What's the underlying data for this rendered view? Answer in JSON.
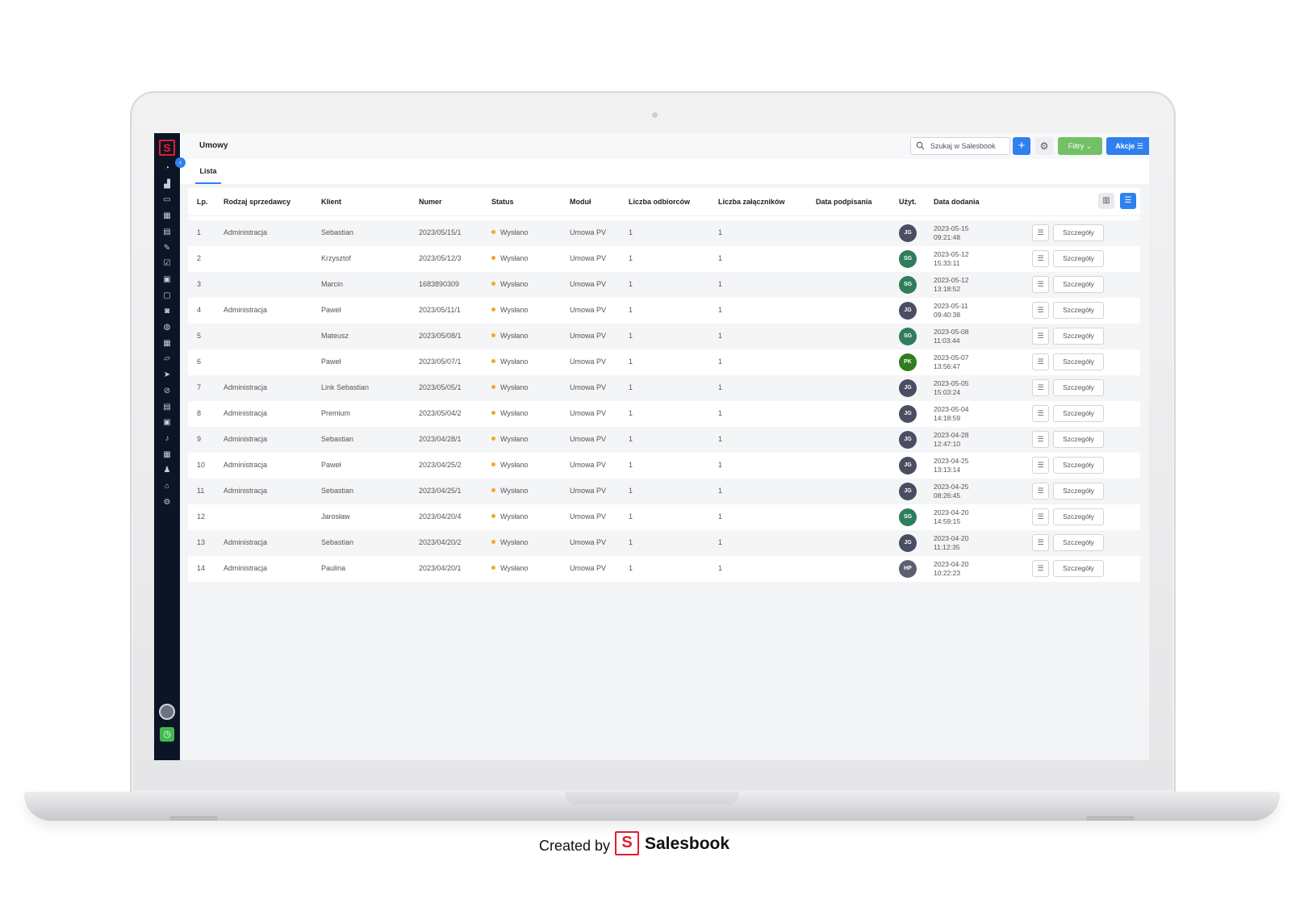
{
  "app": {
    "logo_letter": "S",
    "page_title": "Umowy",
    "search_placeholder": "Szukaj w Salesbook",
    "add_label": "+",
    "settings_glyph": "⚙",
    "filters_label": "Filtry ⌄",
    "actions_label": "Akcje ☰",
    "tabs": [
      {
        "label": "Lista",
        "active": true
      }
    ],
    "accent_color": "#2f80ed",
    "filters_color": "#73c066"
  },
  "sidebar": {
    "icons": [
      "dashboard-icon",
      "chart-icon",
      "chat-icon",
      "building-icon",
      "report-icon",
      "notes-icon",
      "tasks-icon",
      "calendar-icon",
      "folder-icon",
      "gallery-icon",
      "globe-icon",
      "solar-panel-icon",
      "inbox-icon",
      "send-icon",
      "link-icon",
      "mail-icon",
      "box-icon",
      "bell-icon",
      "calculator-icon",
      "users-icon",
      "education-icon",
      "gear-icon"
    ]
  },
  "table": {
    "headers": {
      "lp": "Lp.",
      "seller_type": "Rodzaj sprzedawcy",
      "client": "Klient",
      "number": "Numer",
      "status": "Status",
      "module": "Moduł",
      "recipients": "Liczba odbiorców",
      "attachments": "Liczba załączników",
      "signed": "Data podpisania",
      "user": "Użyt.",
      "added": "Data dodania"
    },
    "details_label": "Szczegóły",
    "status_color": "#f5a623",
    "rows": [
      {
        "lp": "1",
        "seller": "Administracja",
        "client": "Sebastian",
        "number": "2023/05/15/1",
        "status": "Wysłano",
        "module": "Umowa PV",
        "recipients": "1",
        "attachments": "1",
        "user": "JG",
        "user_color": "#4a4e63",
        "date": "2023-05-15",
        "time": "09:21:48"
      },
      {
        "lp": "2",
        "seller": "",
        "client": "Krzysztof",
        "number": "2023/05/12/3",
        "status": "Wysłano",
        "module": "Umowa PV",
        "recipients": "1",
        "attachments": "1",
        "user": "SG",
        "user_color": "#2e7d5b",
        "date": "2023-05-12",
        "time": "15:33:11"
      },
      {
        "lp": "3",
        "seller": "",
        "client": "Marcin",
        "number": "1683890309",
        "status": "Wysłano",
        "module": "Umowa PV",
        "recipients": "1",
        "attachments": "1",
        "user": "SG",
        "user_color": "#2e7d5b",
        "date": "2023-05-12",
        "time": "13:18:52"
      },
      {
        "lp": "4",
        "seller": "Administracja",
        "client": "Paweł",
        "number": "2023/05/11/1",
        "status": "Wysłano",
        "module": "Umowa PV",
        "recipients": "1",
        "attachments": "1",
        "user": "JG",
        "user_color": "#4a4e63",
        "date": "2023-05-11",
        "time": "09:40:38"
      },
      {
        "lp": "5",
        "seller": "",
        "client": "Mateusz",
        "number": "2023/05/08/1",
        "status": "Wysłano",
        "module": "Umowa PV",
        "recipients": "1",
        "attachments": "1",
        "user": "SG",
        "user_color": "#2e7d5b",
        "date": "2023-05-08",
        "time": "11:03:44"
      },
      {
        "lp": "6",
        "seller": "",
        "client": "Paweł",
        "number": "2023/05/07/1",
        "status": "Wysłano",
        "module": "Umowa PV",
        "recipients": "1",
        "attachments": "1",
        "user": "PK",
        "user_color": "#2e7d1e",
        "date": "2023-05-07",
        "time": "13:56:47"
      },
      {
        "lp": "7",
        "seller": "Administracja",
        "client": "Link Sebastian",
        "number": "2023/05/05/1",
        "status": "Wysłano",
        "module": "Umowa PV",
        "recipients": "1",
        "attachments": "1",
        "user": "JG",
        "user_color": "#4a4e63",
        "date": "2023-05-05",
        "time": "15:03:24"
      },
      {
        "lp": "8",
        "seller": "Administracja",
        "client": "Premium",
        "number": "2023/05/04/2",
        "status": "Wysłano",
        "module": "Umowa PV",
        "recipients": "1",
        "attachments": "1",
        "user": "JG",
        "user_color": "#4a4e63",
        "date": "2023-05-04",
        "time": "14:18:59"
      },
      {
        "lp": "9",
        "seller": "Administracja",
        "client": "Sebastian",
        "number": "2023/04/28/1",
        "status": "Wysłano",
        "module": "Umowa PV",
        "recipients": "1",
        "attachments": "1",
        "user": "JG",
        "user_color": "#4a4e63",
        "date": "2023-04-28",
        "time": "12:47:10"
      },
      {
        "lp": "10",
        "seller": "Administracja",
        "client": "Paweł",
        "number": "2023/04/25/2",
        "status": "Wysłano",
        "module": "Umowa PV",
        "recipients": "1",
        "attachments": "1",
        "user": "JG",
        "user_color": "#4a4e63",
        "date": "2023-04-25",
        "time": "13:13:14"
      },
      {
        "lp": "11",
        "seller": "Administracja",
        "client": "Sebastian",
        "number": "2023/04/25/1",
        "status": "Wysłano",
        "module": "Umowa PV",
        "recipients": "1",
        "attachments": "1",
        "user": "JG",
        "user_color": "#4a4e63",
        "date": "2023-04-25",
        "time": "08:26:45"
      },
      {
        "lp": "12",
        "seller": "",
        "client": "Jarosław",
        "number": "2023/04/20/4",
        "status": "Wysłano",
        "module": "Umowa PV",
        "recipients": "1",
        "attachments": "1",
        "user": "SG",
        "user_color": "#2e7d5b",
        "date": "2023-04-20",
        "time": "14:59:15"
      },
      {
        "lp": "13",
        "seller": "Administracja",
        "client": "Sebastian",
        "number": "2023/04/20/2",
        "status": "Wysłano",
        "module": "Umowa PV",
        "recipients": "1",
        "attachments": "1",
        "user": "JG",
        "user_color": "#4a4e63",
        "date": "2023-04-20",
        "time": "11:12:35"
      },
      {
        "lp": "14",
        "seller": "Administracja",
        "client": "Paulina",
        "number": "2023/04/20/1",
        "status": "Wysłano",
        "module": "Umowa PV",
        "recipients": "1",
        "attachments": "1",
        "user": "HP",
        "user_color": "#5b5f72",
        "date": "2023-04-20",
        "time": "10:22:23"
      }
    ]
  },
  "footer": {
    "created_by": "Created by",
    "brand_letter": "S",
    "brand_name": "Salesbook"
  }
}
